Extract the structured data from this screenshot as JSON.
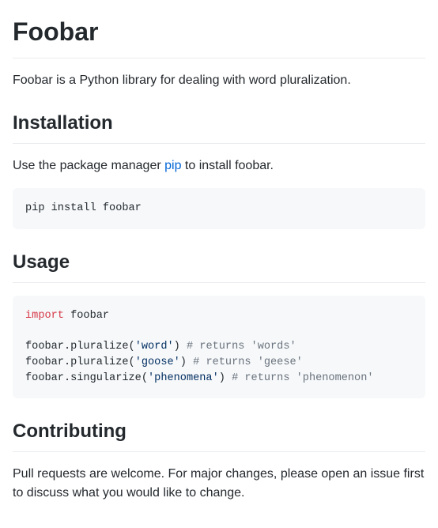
{
  "title": "Foobar",
  "intro": "Foobar is a Python library for dealing with word pluralization.",
  "installation": {
    "heading": "Installation",
    "text_before": "Use the package manager ",
    "link_text": "pip",
    "text_after": " to install foobar.",
    "code": "pip install foobar"
  },
  "usage": {
    "heading": "Usage",
    "code": {
      "import_kw": "import",
      "import_mod": " foobar",
      "line1_pre": "foobar.pluralize(",
      "line1_str": "'word'",
      "line1_post": ") ",
      "line1_com": "# returns 'words'",
      "line2_pre": "foobar.pluralize(",
      "line2_str": "'goose'",
      "line2_post": ") ",
      "line2_com": "# returns 'geese'",
      "line3_pre": "foobar.singularize(",
      "line3_str": "'phenomena'",
      "line3_post": ") ",
      "line3_com": "# returns 'phenomenon'"
    }
  },
  "contributing": {
    "heading": "Contributing",
    "text": "Pull requests are welcome. For major changes, please open an issue first to discuss what you would like to change."
  }
}
